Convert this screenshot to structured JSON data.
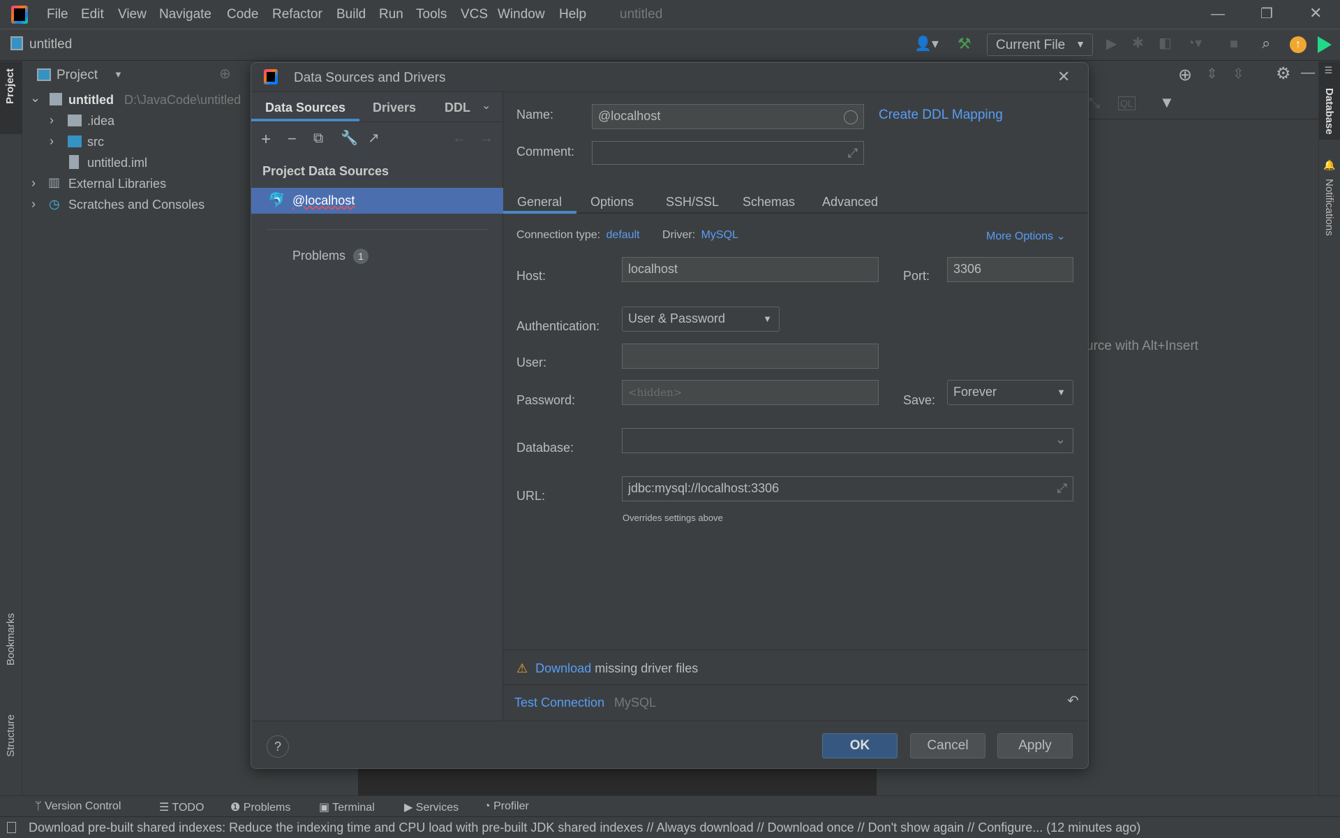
{
  "menubar": {
    "items": [
      "File",
      "Edit",
      "View",
      "Navigate",
      "Code",
      "Refactor",
      "Build",
      "Run",
      "Tools",
      "VCS",
      "Window",
      "Help"
    ],
    "window_title": "untitled"
  },
  "toolbar": {
    "project_name": "untitled",
    "run_config": "Current File"
  },
  "left_stripe": {
    "project": "Project",
    "bookmarks": "Bookmarks",
    "structure": "Structure"
  },
  "right_stripe": {
    "database": "Database",
    "notifications": "Notifications"
  },
  "project_panel": {
    "title": "Project",
    "tree": [
      {
        "label": "untitled",
        "path": "D:\\JavaCode\\untitled"
      },
      {
        "label": ".idea"
      },
      {
        "label": "src"
      },
      {
        "label": "untitled.iml"
      },
      {
        "label": "External Libraries"
      },
      {
        "label": "Scratches and Consoles"
      }
    ]
  },
  "database_panel": {
    "hint": "urce with Alt+Insert"
  },
  "dialog": {
    "title": "Data Sources and Drivers",
    "left_tabs": [
      "Data Sources",
      "Drivers",
      "DDL"
    ],
    "section_title": "Project Data Sources",
    "selected_source": "@localhost",
    "problems_label": "Problems",
    "problems_count": "1",
    "name_label": "Name:",
    "name_value": "@localhost",
    "comment_label": "Comment:",
    "comment_value": "",
    "create_ddl_link": "Create DDL Mapping",
    "tabs": [
      "General",
      "Options",
      "SSH/SSL",
      "Schemas",
      "Advanced"
    ],
    "active_tab": "General",
    "connection_type_label": "Connection type:",
    "connection_type_value": "default",
    "driver_label": "Driver:",
    "driver_value": "MySQL",
    "more_options": "More Options",
    "host_label": "Host:",
    "host_value": "localhost",
    "port_label": "Port:",
    "port_value": "3306",
    "auth_label": "Authentication:",
    "auth_value": "User & Password",
    "user_label": "User:",
    "user_value": "",
    "password_label": "Password:",
    "password_placeholder": "<hidden>",
    "save_label": "Save:",
    "save_value": "Forever",
    "database_label": "Database:",
    "database_value": "",
    "url_label": "URL:",
    "url_value": "jdbc:mysql://localhost:3306",
    "url_hint": "Overrides settings above",
    "warning_link": "Download",
    "warning_text": "missing driver files",
    "test_connection": "Test Connection",
    "test_driver": "MySQL",
    "ok": "OK",
    "cancel": "Cancel",
    "apply": "Apply",
    "help": "?"
  },
  "bottom_tabs": [
    "Version Control",
    "TODO",
    "Problems",
    "Terminal",
    "Services",
    "Profiler"
  ],
  "status": "Download pre-built shared indexes: Reduce the indexing time and CPU load with pre-built JDK shared indexes // Always download // Download once // Don't show again // Configure... (12 minutes ago)",
  "colors": {
    "accent": "#4a88c7",
    "selection": "#4b6eaf",
    "link": "#589df6",
    "warning": "#f0a732",
    "background": "#3c3f41"
  }
}
